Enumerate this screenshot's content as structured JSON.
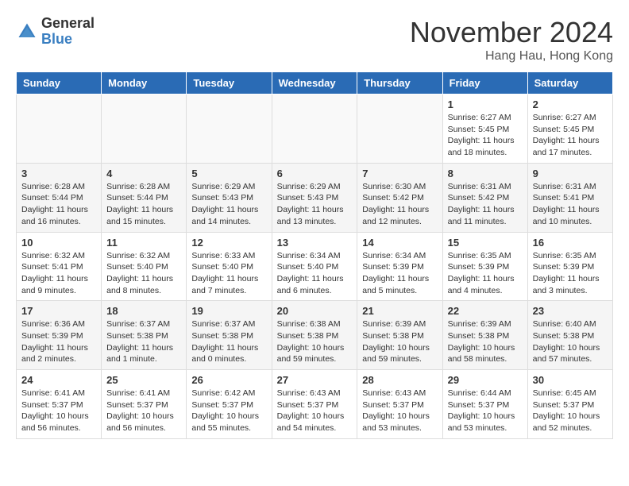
{
  "logo": {
    "general": "General",
    "blue": "Blue"
  },
  "title": "November 2024",
  "location": "Hang Hau, Hong Kong",
  "days_of_week": [
    "Sunday",
    "Monday",
    "Tuesday",
    "Wednesday",
    "Thursday",
    "Friday",
    "Saturday"
  ],
  "weeks": [
    [
      {
        "day": "",
        "info": ""
      },
      {
        "day": "",
        "info": ""
      },
      {
        "day": "",
        "info": ""
      },
      {
        "day": "",
        "info": ""
      },
      {
        "day": "",
        "info": ""
      },
      {
        "day": "1",
        "info": "Sunrise: 6:27 AM\nSunset: 5:45 PM\nDaylight: 11 hours and 18 minutes."
      },
      {
        "day": "2",
        "info": "Sunrise: 6:27 AM\nSunset: 5:45 PM\nDaylight: 11 hours and 17 minutes."
      }
    ],
    [
      {
        "day": "3",
        "info": "Sunrise: 6:28 AM\nSunset: 5:44 PM\nDaylight: 11 hours and 16 minutes."
      },
      {
        "day": "4",
        "info": "Sunrise: 6:28 AM\nSunset: 5:44 PM\nDaylight: 11 hours and 15 minutes."
      },
      {
        "day": "5",
        "info": "Sunrise: 6:29 AM\nSunset: 5:43 PM\nDaylight: 11 hours and 14 minutes."
      },
      {
        "day": "6",
        "info": "Sunrise: 6:29 AM\nSunset: 5:43 PM\nDaylight: 11 hours and 13 minutes."
      },
      {
        "day": "7",
        "info": "Sunrise: 6:30 AM\nSunset: 5:42 PM\nDaylight: 11 hours and 12 minutes."
      },
      {
        "day": "8",
        "info": "Sunrise: 6:31 AM\nSunset: 5:42 PM\nDaylight: 11 hours and 11 minutes."
      },
      {
        "day": "9",
        "info": "Sunrise: 6:31 AM\nSunset: 5:41 PM\nDaylight: 11 hours and 10 minutes."
      }
    ],
    [
      {
        "day": "10",
        "info": "Sunrise: 6:32 AM\nSunset: 5:41 PM\nDaylight: 11 hours and 9 minutes."
      },
      {
        "day": "11",
        "info": "Sunrise: 6:32 AM\nSunset: 5:40 PM\nDaylight: 11 hours and 8 minutes."
      },
      {
        "day": "12",
        "info": "Sunrise: 6:33 AM\nSunset: 5:40 PM\nDaylight: 11 hours and 7 minutes."
      },
      {
        "day": "13",
        "info": "Sunrise: 6:34 AM\nSunset: 5:40 PM\nDaylight: 11 hours and 6 minutes."
      },
      {
        "day": "14",
        "info": "Sunrise: 6:34 AM\nSunset: 5:39 PM\nDaylight: 11 hours and 5 minutes."
      },
      {
        "day": "15",
        "info": "Sunrise: 6:35 AM\nSunset: 5:39 PM\nDaylight: 11 hours and 4 minutes."
      },
      {
        "day": "16",
        "info": "Sunrise: 6:35 AM\nSunset: 5:39 PM\nDaylight: 11 hours and 3 minutes."
      }
    ],
    [
      {
        "day": "17",
        "info": "Sunrise: 6:36 AM\nSunset: 5:39 PM\nDaylight: 11 hours and 2 minutes."
      },
      {
        "day": "18",
        "info": "Sunrise: 6:37 AM\nSunset: 5:38 PM\nDaylight: 11 hours and 1 minute."
      },
      {
        "day": "19",
        "info": "Sunrise: 6:37 AM\nSunset: 5:38 PM\nDaylight: 11 hours and 0 minutes."
      },
      {
        "day": "20",
        "info": "Sunrise: 6:38 AM\nSunset: 5:38 PM\nDaylight: 10 hours and 59 minutes."
      },
      {
        "day": "21",
        "info": "Sunrise: 6:39 AM\nSunset: 5:38 PM\nDaylight: 10 hours and 59 minutes."
      },
      {
        "day": "22",
        "info": "Sunrise: 6:39 AM\nSunset: 5:38 PM\nDaylight: 10 hours and 58 minutes."
      },
      {
        "day": "23",
        "info": "Sunrise: 6:40 AM\nSunset: 5:38 PM\nDaylight: 10 hours and 57 minutes."
      }
    ],
    [
      {
        "day": "24",
        "info": "Sunrise: 6:41 AM\nSunset: 5:37 PM\nDaylight: 10 hours and 56 minutes."
      },
      {
        "day": "25",
        "info": "Sunrise: 6:41 AM\nSunset: 5:37 PM\nDaylight: 10 hours and 56 minutes."
      },
      {
        "day": "26",
        "info": "Sunrise: 6:42 AM\nSunset: 5:37 PM\nDaylight: 10 hours and 55 minutes."
      },
      {
        "day": "27",
        "info": "Sunrise: 6:43 AM\nSunset: 5:37 PM\nDaylight: 10 hours and 54 minutes."
      },
      {
        "day": "28",
        "info": "Sunrise: 6:43 AM\nSunset: 5:37 PM\nDaylight: 10 hours and 53 minutes."
      },
      {
        "day": "29",
        "info": "Sunrise: 6:44 AM\nSunset: 5:37 PM\nDaylight: 10 hours and 53 minutes."
      },
      {
        "day": "30",
        "info": "Sunrise: 6:45 AM\nSunset: 5:37 PM\nDaylight: 10 hours and 52 minutes."
      }
    ]
  ]
}
